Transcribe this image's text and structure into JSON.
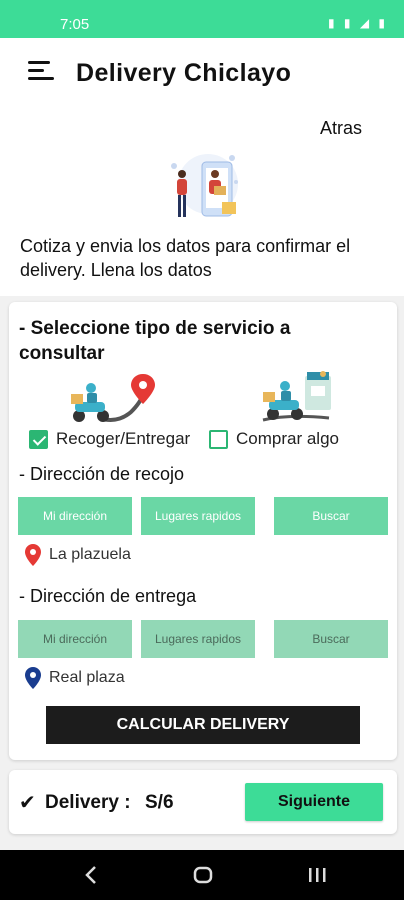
{
  "status_bar": {
    "time": "7:05",
    "icons": "▮ ▮ ◢ ▮"
  },
  "app_bar": {
    "title": "Delivery Chiclayo",
    "menu_icon": "hamburger-menu-icon"
  },
  "top": {
    "back_label": "Atras",
    "hero_icon": "delivery-person-phone-illustration",
    "intro": "Cotiza y envia los datos para confirmar el delivery. Llena los datos"
  },
  "form": {
    "title": "- Seleccione tipo de servicio a consultar",
    "service_icons": [
      "delivery-route-icon",
      "delivery-store-icon"
    ],
    "options": [
      {
        "label": "Recoger/Entregar",
        "checked": true
      },
      {
        "label": "Comprar algo",
        "checked": false
      }
    ],
    "pickup": {
      "label": "- Dirección de recojo",
      "buttons": [
        "Mi dirección",
        "Lugares rapidos",
        "Buscar"
      ],
      "place": "La plazuela",
      "pin_color": "#e53935"
    },
    "dropoff": {
      "label": "- Dirección de entrega",
      "buttons": [
        "Mi dirección",
        "Lugares rapidos",
        "Buscar"
      ],
      "place": "Real plaza",
      "pin_color": "#1a3d8f"
    },
    "calculate_label": "CALCULAR DELIVERY"
  },
  "footer": {
    "check_mark": "✔",
    "delivery_label": "Delivery :",
    "delivery_value": "S/6",
    "next_label": "Siguiente"
  },
  "colors": {
    "accent": "#3ddc97",
    "button": "#6ad7a5",
    "dark": "#1c1c1c"
  }
}
